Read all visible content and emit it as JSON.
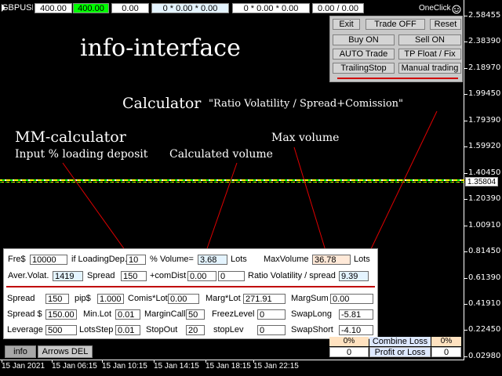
{
  "top_bar": {
    "symbol": "GBPUSD",
    "lot1": "400.00",
    "lot2": "400.00",
    "value": "0.00",
    "ratio1": "0 * 0.00 * 0.00",
    "ratio2": "0 * 0.00 * 0.00",
    "pl": "0.00 / 0.00",
    "oneclick": "OneClick"
  },
  "control_panel": {
    "exit": "Exit",
    "trade_off": "Trade OFF",
    "reset": "Reset",
    "buy_on": "Buy ON",
    "sell_on": "Sell ON",
    "auto_trade": "AUTO Trade",
    "tp_float": "TP Float / Fix",
    "trailing_stop": "TrailingStop",
    "manual_trading": "Manual trading"
  },
  "annotations": {
    "title": "info-interface",
    "calculator": "Calculator",
    "calculator_desc": "\"Ratio Volatility / Spread+Comission\"",
    "mm_calc": "MM-calculator",
    "input_pct": "Input % loading deposit",
    "calc_volume": "Calculated volume",
    "max_volume": "Max volume"
  },
  "price_axis": {
    "labels": [
      "2.58455",
      "2.38390",
      "2.18970",
      "1.99450",
      "1.79390",
      "1.59920",
      "1.40450",
      "1.20390",
      "1.00910",
      "0.81450",
      "0.61390",
      "0.41910",
      "0.22450",
      "0.02980"
    ],
    "current": "1.35804",
    "current_color": "#ffffff"
  },
  "time_axis": [
    "15 Jan 2021",
    "15 Jan 06:15",
    "15 Jan 10:15",
    "15 Jan 14:15",
    "15 Jan 18:15",
    "15 Jan 22:15"
  ],
  "panel_row1": {
    "fre_label": "Fre$",
    "fre_value": "10000",
    "if_loading_label": "if LoadingDep.",
    "loading_value": "10",
    "pct_volume_label": "% Volume=",
    "volume_value": "3.68",
    "lots_label": "Lots",
    "maxvol_label": "MaxVolume",
    "maxvol_value": "36.78",
    "lots_label2": "Lots"
  },
  "panel_row2": {
    "aver_label": "Aver.Volat.",
    "aver_value": "1419",
    "spread_label": "Spread",
    "spread_value": "150",
    "comdist_label": "+comDist",
    "comdist_value1": "0.00",
    "comdist_value2": "0",
    "ratio_label": "Ratio Volatility / spread",
    "ratio_value": "9.39"
  },
  "panel_row3": {
    "spread_label": "Spread",
    "spread_value": "150",
    "pip_label": "pip$",
    "pip_value": "1.000",
    "comis_label": "Comis*Lot",
    "comis_value": "0.00",
    "marg_label": "Marg*Lot",
    "marg_value": "271.91",
    "margsum_label": "MargSum",
    "margsum_value": "0.00"
  },
  "panel_row4": {
    "spread_usd_label": "Spread $",
    "spread_usd_value": "150.00",
    "minlot_label": "Min.Lot",
    "minlot_value": "0.01",
    "margincall_label": "MarginCall",
    "margincall_value": "50",
    "freez_label": "FreezLevel",
    "freez_value": "0",
    "swaplong_label": "SwapLong",
    "swaplong_value": "-5.81"
  },
  "panel_row5": {
    "leverage_label": "Leverage",
    "leverage_value": "500",
    "lotsstep_label": "LotsStep",
    "lotsstep_value": "0.01",
    "stopout_label": "StopOut",
    "stopout_value": "20",
    "stoplev_label": "stopLev",
    "stoplev_value": "0",
    "swapshort_label": "SwapShort",
    "swapshort_value": "-4.10"
  },
  "right_table": {
    "r1_left": "0%",
    "r1_label": "Combine Loss",
    "r1_right": "0%",
    "r2_left": "0",
    "r2_label": "Profit or Loss",
    "r2_right": "0"
  },
  "tabs": {
    "info": "info",
    "arrows": "Arrows DEL"
  },
  "colors": {
    "lot2_bg": "#00ff00",
    "accent_red": "#ff0000",
    "annotation_line": "#e00000"
  }
}
